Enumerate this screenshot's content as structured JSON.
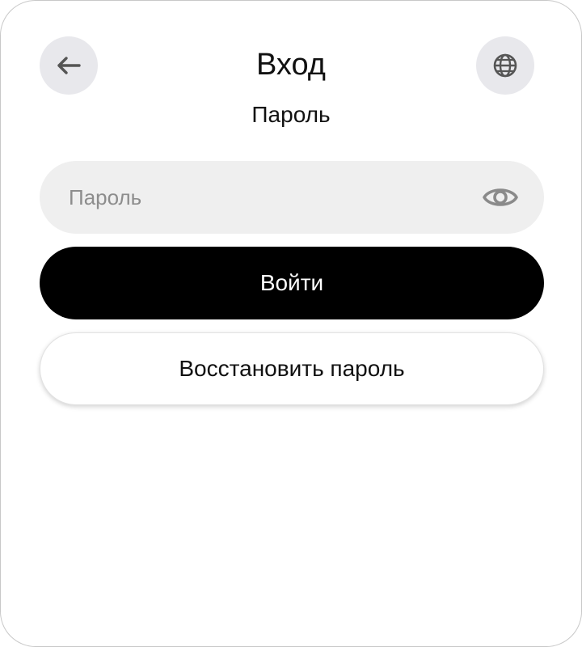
{
  "header": {
    "title": "Вход",
    "subtitle": "Пароль",
    "back_icon": "arrow-left-icon",
    "language_icon": "globe-icon"
  },
  "password_field": {
    "value": "",
    "placeholder": "Пароль",
    "toggle_icon": "eye-icon"
  },
  "buttons": {
    "login_label": "Войти",
    "recover_label": "Восстановить пароль"
  },
  "colors": {
    "primary": "#000000",
    "icon_bg": "#e8e8ec",
    "field_bg": "#efefef",
    "placeholder": "#8d8d8d"
  }
}
